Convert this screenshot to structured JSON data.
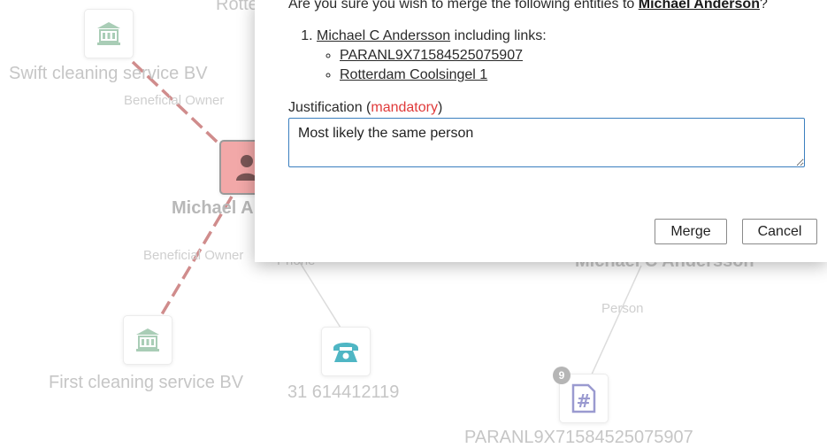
{
  "graph": {
    "top_partial_label": "Rotte",
    "partial_person_right": "Michael C Andersson",
    "nodes": {
      "company_top": {
        "label": "Swift cleaning service BV",
        "icon": "bank-icon"
      },
      "person": {
        "label": "Michael A",
        "icon": "person-icon"
      },
      "company_bottom": {
        "label": "First cleaning service BV",
        "icon": "bank-icon"
      },
      "phone": {
        "label": "31 614412119",
        "icon": "phone-icon"
      },
      "account": {
        "label": "PARANL9X71584525075907",
        "icon": "hash-document-icon",
        "badge": "9"
      }
    },
    "edges": {
      "beneficial_owner_top": "Beneficial Owner",
      "beneficial_owner_bottom": "Beneficial Owner",
      "phone": "Phone",
      "person": "Person"
    }
  },
  "dialog": {
    "question_prefix": "Are you sure you wish to merge the following entities to ",
    "target_entity": "Michael Anderson",
    "question_suffix": "?",
    "entities": [
      {
        "name": "Michael C Andersson",
        "links_text": " including links:",
        "links": [
          "PARANL9X71584525075907",
          "Rotterdam Coolsingel 1"
        ]
      }
    ],
    "justification_label": "Justification",
    "mandatory_open": " (",
    "mandatory_text": "mandatory",
    "mandatory_close": ")",
    "justification_value": "Most likely the same person",
    "merge_label": "Merge",
    "cancel_label": "Cancel"
  },
  "colors": {
    "edge_dashed": "#d08c8c",
    "edge_solid": "#dcdcdc",
    "company_icon": "#a9cdb6",
    "person_bg": "#f2a8a8",
    "phone_icon": "#4fb6c4",
    "account_icon": "#9a9ad0",
    "mandatory": "#e03a3a",
    "input_border": "#3b7fbf"
  }
}
